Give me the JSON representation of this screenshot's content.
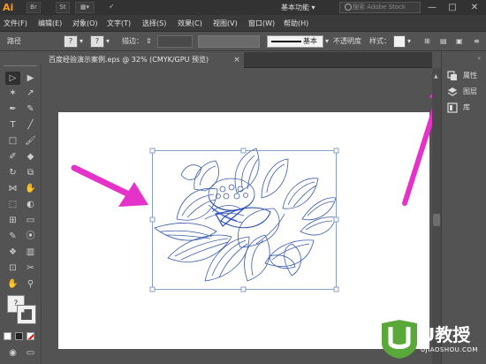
{
  "app": {
    "logo": "Ai",
    "bridge": "Br",
    "stock": "St"
  },
  "titlebar": {
    "workspace": "基本功能",
    "search_placeholder": "搜索 Adobe Stock",
    "minimize": "—",
    "maximize": "□",
    "close": "✕"
  },
  "menu": [
    "文件(F)",
    "编辑(E)",
    "对象(O)",
    "文字(T)",
    "选择(S)",
    "效果(C)",
    "视图(V)",
    "窗口(W)",
    "帮助(H)"
  ],
  "controlbar": {
    "mode_label": "路径",
    "stroke_label": "描边：",
    "stroke_style": "基本",
    "opacity_label": "不透明度",
    "style_label": "样式："
  },
  "document_tab": {
    "title": "百度经验演示案例.eps @ 32% (CMYK/GPU 预览)",
    "close": "×"
  },
  "panels": [
    {
      "name": "properties",
      "label": "属性",
      "icon": "properties-icon"
    },
    {
      "name": "layers",
      "label": "图层",
      "icon": "layers-icon"
    },
    {
      "name": "libraries",
      "label": "库",
      "icon": "libraries-icon"
    }
  ],
  "tools": [
    "selection-tool",
    "direct-selection-tool",
    "magic-wand-tool",
    "lasso-tool",
    "pen-tool",
    "curvature-tool",
    "type-tool",
    "line-tool",
    "rectangle-tool",
    "paintbrush-tool",
    "shaper-tool",
    "eraser-tool",
    "rotate-tool",
    "scale-tool",
    "width-tool",
    "warp-tool",
    "free-transform-tool",
    "shape-builder-tool",
    "perspective-grid-tool",
    "mesh-tool",
    "gradient-tool",
    "eyedropper-tool",
    "blend-tool",
    "symbol-sprayer-tool",
    "column-graph-tool",
    "artboard-tool",
    "slice-tool",
    "hand-tool",
    "zoom-tool"
  ],
  "watermark": {
    "brand": "U教授",
    "url": "UJIAOSHOU.COM"
  },
  "colors": {
    "accent_arrow": "#e532c8",
    "stroke_art": "#3a5ca8",
    "workspace_bg": "#535353"
  }
}
